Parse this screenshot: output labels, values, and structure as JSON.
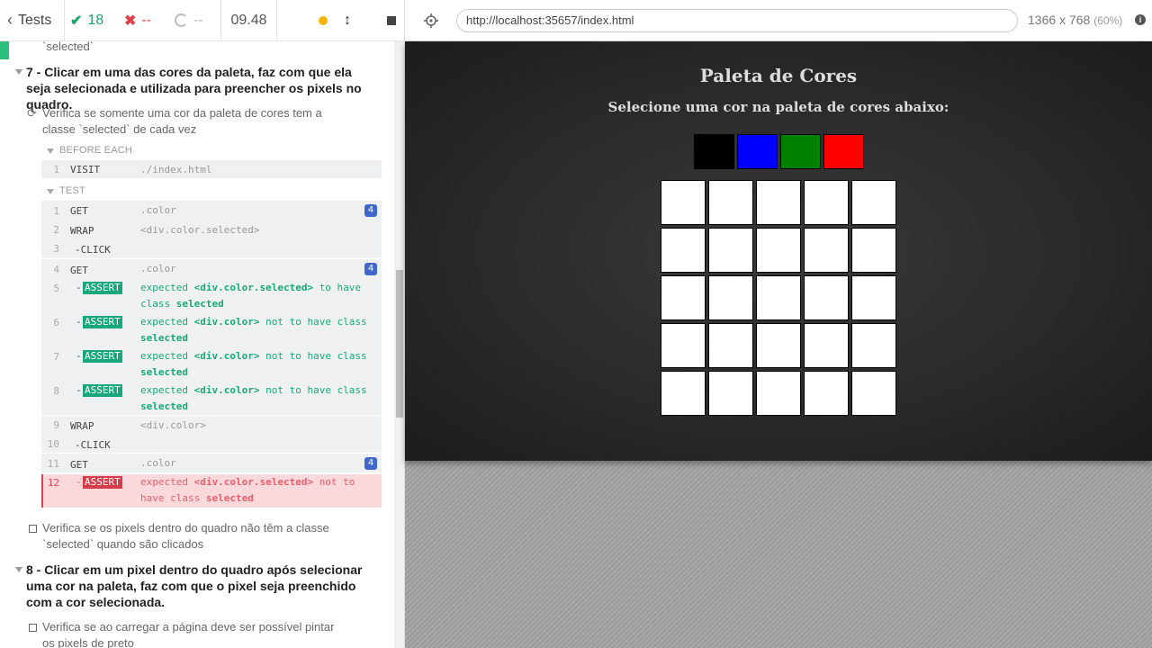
{
  "header": {
    "tests_label": "Tests",
    "passed": "18",
    "failed": "--",
    "pending": "--",
    "duration": "09.48"
  },
  "runner": {
    "prev_text": "`selected`",
    "suite7_title": "7 - Clicar em uma das cores da paleta, faz com que ela seja selecionada e utilizada para preencher os pixels no quadro.",
    "test_active_title": "Verifica se somente uma cor da paleta de cores tem a classe `selected` de cada vez",
    "before_each_label": "BEFORE EACH",
    "test_label": "TEST",
    "before_each_cmd": {
      "num": "1",
      "name": "VISIT",
      "msg": "./index.html"
    },
    "commands": [
      {
        "num": "1",
        "name": "GET",
        "msg": ".color",
        "badge": "4"
      },
      {
        "num": "2",
        "name": "WRAP",
        "msg": "<div.color.selected>"
      },
      {
        "num": "3",
        "name": "-CLICK",
        "msg": ""
      },
      {
        "num": "4",
        "name": "GET",
        "msg": ".color",
        "badge": "4"
      },
      {
        "num": "5",
        "assert": "ASSERT",
        "prefix": "expected",
        "subject": "<div.color.selected>",
        "mid": "to have class",
        "cls": "selected"
      },
      {
        "num": "6",
        "assert": "ASSERT",
        "prefix": "expected",
        "subject": "<div.color>",
        "mid": "not to have class",
        "cls": "selected"
      },
      {
        "num": "7",
        "assert": "ASSERT",
        "prefix": "expected",
        "subject": "<div.color>",
        "mid": "not to have class",
        "cls": "selected"
      },
      {
        "num": "8",
        "assert": "ASSERT",
        "prefix": "expected",
        "subject": "<div.color>",
        "mid": "not to have class",
        "cls": "selected"
      },
      {
        "num": "9",
        "name": "WRAP",
        "msg": "<div.color>"
      },
      {
        "num": "10",
        "name": "-CLICK",
        "msg": ""
      },
      {
        "num": "11",
        "name": "GET",
        "msg": ".color",
        "badge": "4"
      },
      {
        "num": "12",
        "assert": "ASSERT",
        "prefix": "expected",
        "subject": "<div.color.selected>",
        "mid": "not to have class",
        "cls": "selected"
      }
    ],
    "test_pending_1": "Verifica se os pixels dentro do quadro não têm a classe `selected` quando são clicados",
    "suite8_title": "8 - Clicar em um pixel dentro do quadro após selecionar uma cor na paleta, faz com que o pixel seja preenchido com a cor selecionada.",
    "test_pending_2": "Verifica se ao carregar a página deve ser possível pintar os pixels de preto"
  },
  "browser": {
    "url": "http://localhost:35657/index.html",
    "viewport": "1366 x 768",
    "scale": "(60%)"
  },
  "app": {
    "title": "Paleta de Cores",
    "subtitle": "Selecione uma cor na paleta de cores abaixo:",
    "palette_colors": [
      "#000000",
      "#0000ff",
      "#008000",
      "#ff0000"
    ],
    "board_size": 5
  },
  "colors": {
    "pass": "#1aa56b",
    "fail": "#e0444a",
    "badge": "#3f67c9"
  }
}
